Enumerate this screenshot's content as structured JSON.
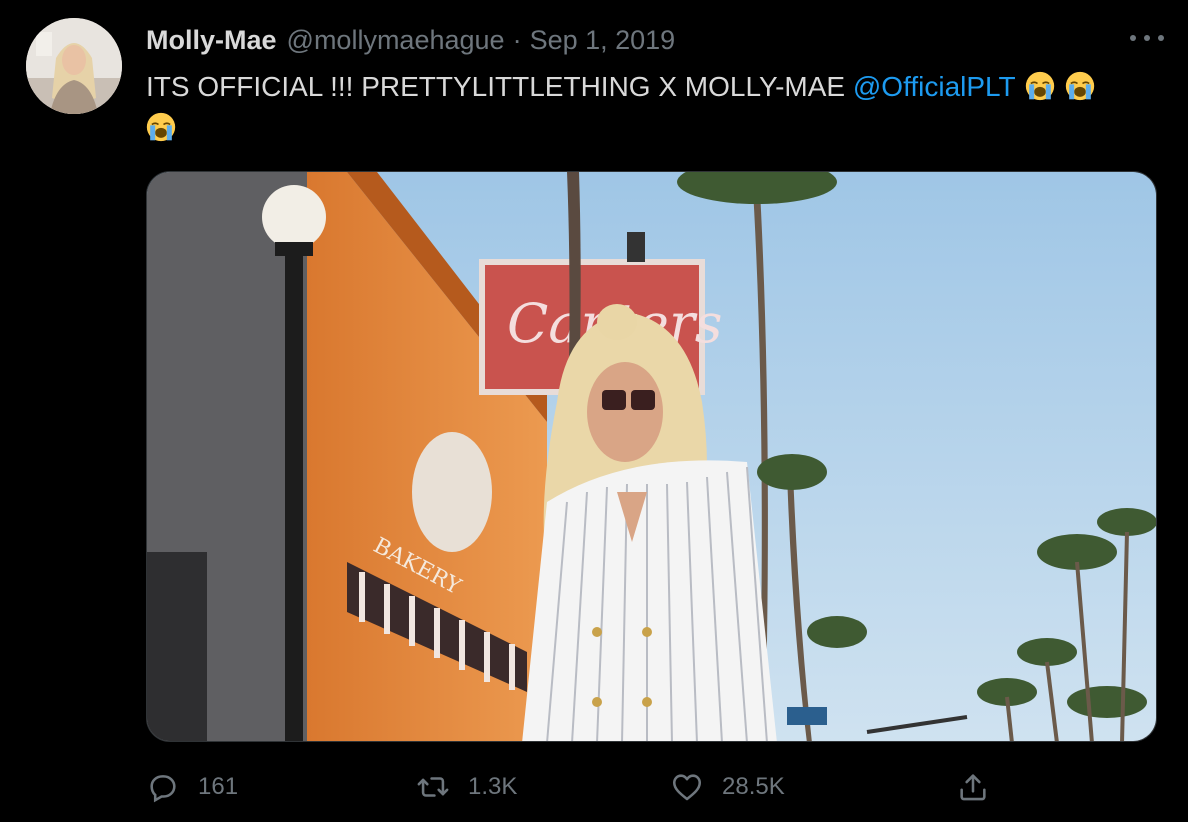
{
  "author": {
    "name": "Molly-Mae",
    "handle": "@mollymaehague",
    "separator": "·",
    "date": "Sep 1, 2019"
  },
  "tweet": {
    "text": "ITS OFFICIAL !!! PRETTYLITTLETHING X MOLLY-MAE",
    "mention": "@OfficialPLT",
    "emoji": "loudly-crying-face"
  },
  "media": {
    "sign_text": "Canters",
    "bakery_text": "BAKERY"
  },
  "actions": {
    "replies": "161",
    "retweets": "1.3K",
    "likes": "28.5K"
  },
  "icons": {
    "reply": "reply-icon",
    "retweet": "retweet-icon",
    "like": "heart-icon",
    "share": "share-icon",
    "more": "more-icon"
  },
  "colors": {
    "background": "#000000",
    "text": "#d9d9d9",
    "muted": "#6e767d",
    "link": "#1d9bf0"
  }
}
